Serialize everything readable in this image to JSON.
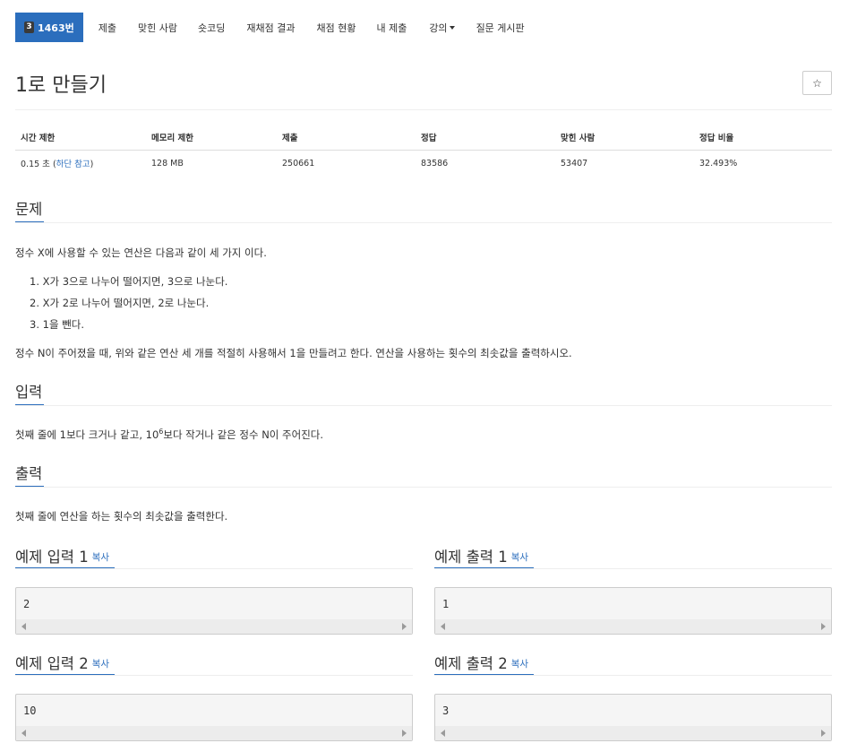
{
  "nav": {
    "tier_glyph": "3",
    "problem_tab": "1463번",
    "items": [
      "제출",
      "맞힌 사람",
      "숏코딩",
      "재채점 결과",
      "채점 현황",
      "내 제출",
      "강의",
      "질문 게시판"
    ]
  },
  "problem": {
    "title": "1로 만들기",
    "star_glyph": "☆"
  },
  "info_table": {
    "headers": [
      "시간 제한",
      "메모리 제한",
      "제출",
      "정답",
      "맞힌 사람",
      "정답 비율"
    ],
    "time_value": "0.15 초",
    "time_note_open": " (",
    "time_note_link": "하단 참고",
    "time_note_close": ")",
    "memory": "128 MB",
    "submissions": "250661",
    "correct": "83586",
    "solvers": "53407",
    "ratio": "32.493%"
  },
  "sections": {
    "problem_heading": "문제",
    "problem_intro": "정수 X에 사용할 수 있는 연산은 다음과 같이 세 가지 이다.",
    "ops": [
      "1. X가 3으로 나누어 떨어지면, 3으로 나눈다.",
      "2. X가 2로 나누어 떨어지면, 2로 나눈다.",
      "3. 1을 뺀다."
    ],
    "problem_outro": "정수 N이 주어졌을 때, 위와 같은 연산 세 개를 적절히 사용해서 1을 만들려고 한다. 연산을 사용하는 횟수의 최솟값을 출력하시오.",
    "input_heading": "입력",
    "input_text_a": "첫째 줄에 1보다 크거나 같고, 10",
    "input_sup": "6",
    "input_text_b": "보다 작거나 같은 정수 N이 주어진다.",
    "output_heading": "출력",
    "output_text": "첫째 줄에 연산을 하는 횟수의 최솟값을 출력한다."
  },
  "samples": {
    "copy_label": "복사",
    "in1_title": "예제 입력 1",
    "in1_value": "2",
    "out1_title": "예제 출력 1",
    "out1_value": "1",
    "in2_title": "예제 입력 2",
    "in2_value": "10",
    "out2_title": "예제 출력 2",
    "out2_value": "3"
  },
  "colors": {
    "accent": "#2b6ebd",
    "tier_badge": "#3a3a3a",
    "pre_background": "#f5f5f5"
  }
}
